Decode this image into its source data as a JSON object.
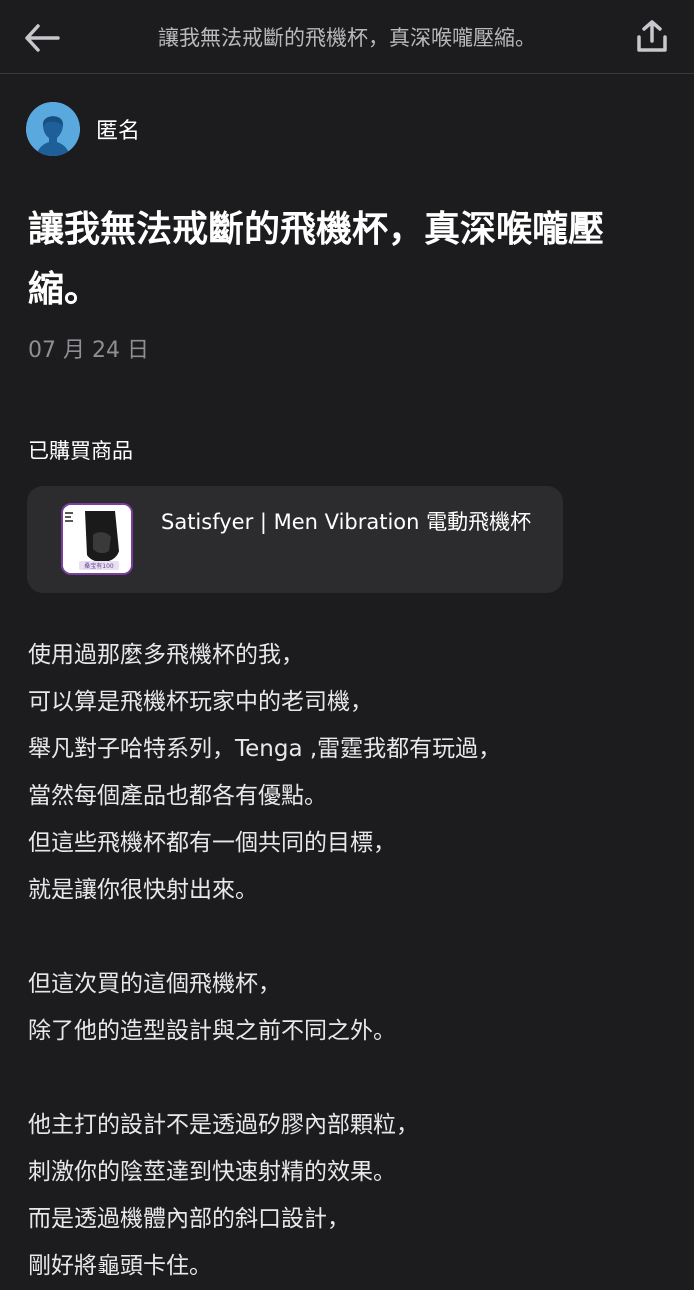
{
  "header": {
    "title": "讓我無法戒斷的飛機杯，真深喉嚨壓縮。"
  },
  "author": {
    "name": "匿名"
  },
  "post": {
    "title": "讓我無法戒斷的飛機杯，真深喉嚨壓縮。",
    "date": "07 月 24 日"
  },
  "purchase": {
    "label": "已購買商品",
    "product_name": "Satisfyer | Men Vibration 電動飛機杯",
    "thumb_badge": "桑宝有100"
  },
  "body": {
    "paragraphs": [
      [
        "使用過那麼多飛機杯的我，",
        "可以算是飛機杯玩家中的老司機，",
        "舉凡對子哈特系列，Tenga ,雷霆我都有玩過，",
        "當然每個產品也都各有優點。",
        "但這些飛機杯都有一個共同的目標，",
        "就是讓你很快射出來。"
      ],
      [
        "但這次買的這個飛機杯，",
        "除了他的造型設計與之前不同之外。"
      ],
      [
        "他主打的設計不是透過矽膠內部顆粒，",
        "刺激你的陰莖達到快速射精的效果。",
        "而是透過機體內部的斜口設計，",
        "剛好將龜頭卡住。"
      ]
    ]
  },
  "icons": {
    "back": "arrow-left-icon",
    "share": "share-upload-icon",
    "avatar": "anonymous-avatar-icon"
  },
  "colors": {
    "background": "#1c1c1e",
    "card": "#2c2c2e",
    "avatar": "#5aa9de",
    "muted_text": "#8e8e93"
  }
}
